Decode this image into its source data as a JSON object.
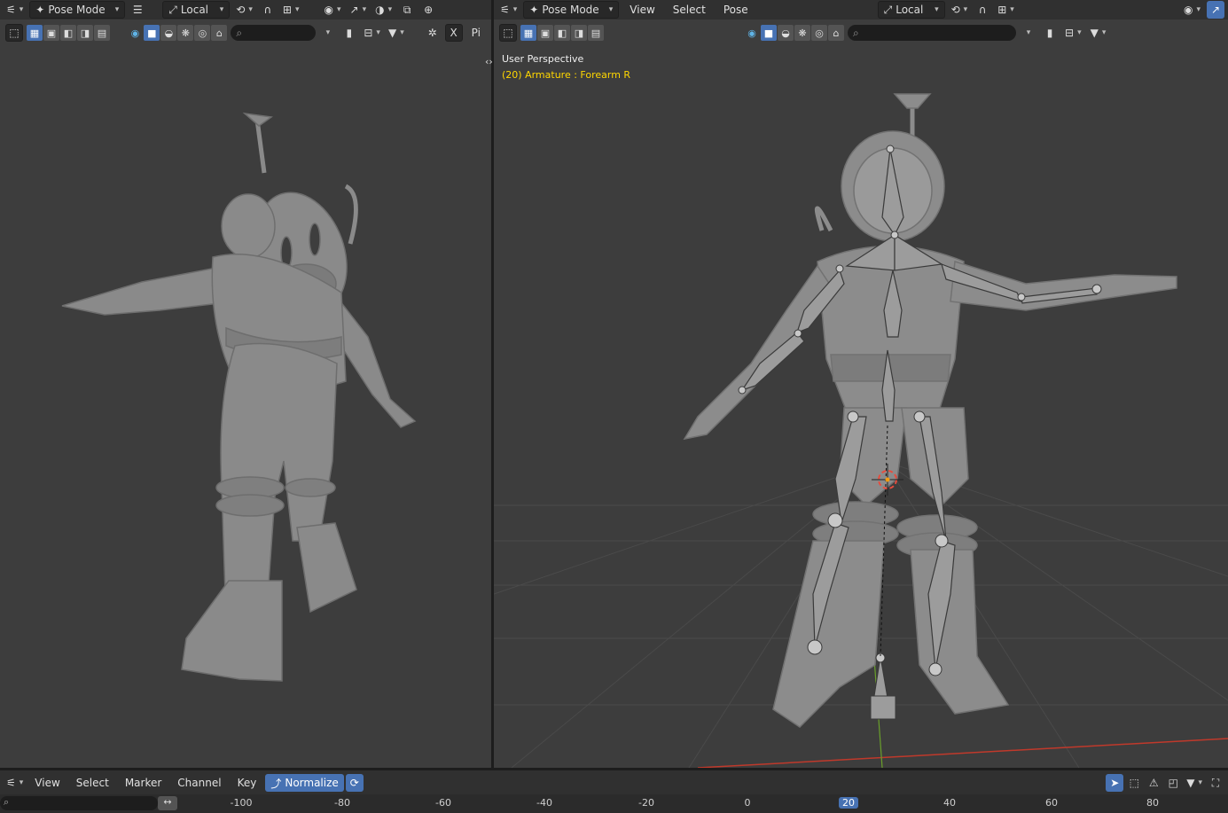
{
  "left_view": {
    "mode_label": "Pose Mode",
    "orientation_label": "Local",
    "tool_search_placeholder": "",
    "trailing_label": "Pi"
  },
  "right_view": {
    "mode_label": "Pose Mode",
    "menus": [
      "View",
      "Select",
      "Pose"
    ],
    "orientation_label": "Local",
    "perspective_text": "User Perspective",
    "active_object_text": "(20) Armature : Forearm R"
  },
  "timeline": {
    "menus": [
      "View",
      "Select",
      "Marker",
      "Channel",
      "Key"
    ],
    "normalize_label": "Normalize",
    "frame_ticks": [
      "-100",
      "-80",
      "-60",
      "-40",
      "-20",
      "0",
      "20",
      "40",
      "60",
      "80"
    ],
    "current_frame": "20"
  },
  "icons": {
    "editor_type": "graph-editor-icon",
    "mode": "pose-mode-icon",
    "transform_orientation": "local-orientation-icon",
    "pivot": "pivot-icon",
    "snap": "magnet-icon",
    "proportional": "proportional-icon",
    "overlays": "overlay-icon",
    "xray": "xray-icon",
    "viewport_shading": "shading-icon",
    "filter": "filter-icon",
    "bookmark": "bookmark-icon",
    "search": "search-icon"
  },
  "colors": {
    "accent": "#4772b3",
    "viewport_bg": "#3d3d3d",
    "header_bg": "#303030",
    "info_yellow": "#ffd700",
    "axis_red": "#c0392b",
    "axis_green": "#6aa02b"
  }
}
